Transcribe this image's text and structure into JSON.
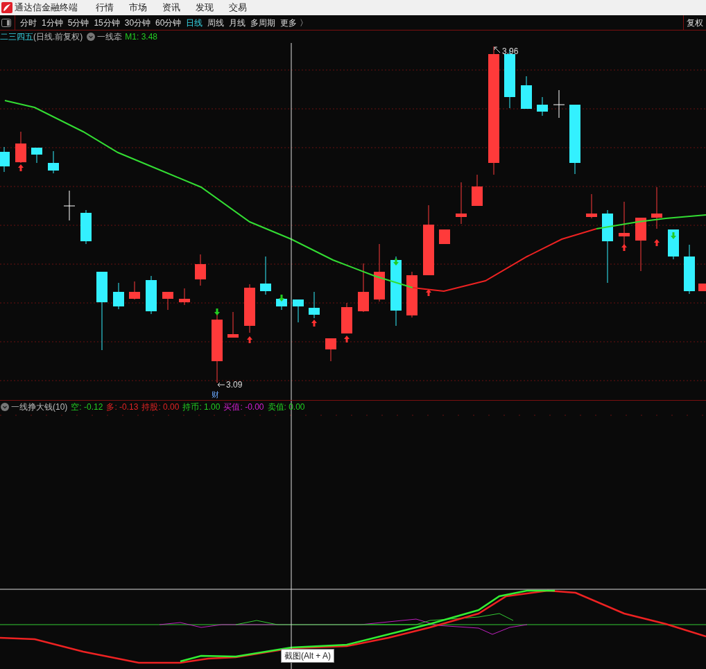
{
  "app": {
    "title": "通达信金融终端",
    "menu": [
      "行情",
      "市场",
      "资讯",
      "发现",
      "交易"
    ]
  },
  "periods": [
    {
      "label": "分时",
      "selected": false
    },
    {
      "label": "1分钟",
      "selected": false
    },
    {
      "label": "5分钟",
      "selected": false
    },
    {
      "label": "15分钟",
      "selected": false
    },
    {
      "label": "30分钟",
      "selected": false
    },
    {
      "label": "60分钟",
      "selected": false
    },
    {
      "label": "日线",
      "selected": true
    },
    {
      "label": "周线",
      "selected": false
    },
    {
      "label": "月线",
      "selected": false
    },
    {
      "label": "多周期",
      "selected": false
    },
    {
      "label": "更多 〉",
      "selected": false
    }
  ],
  "adjust_button": "复权",
  "main_chart": {
    "stock": "二三四五",
    "mode": "(日线.前复权)",
    "indicator": "一线牵",
    "reading": "M1: 3.48",
    "high_label": "3.96",
    "low_label": "3.09",
    "event_badge": "财"
  },
  "sub_chart": {
    "indicator": "一线挣大钱(10)",
    "readings": [
      {
        "label": "空:",
        "value": "-0.12",
        "color": "#22cc22"
      },
      {
        "label": "多:",
        "value": "-0.13",
        "color": "#e02424"
      },
      {
        "label": "持股:",
        "value": "0.00",
        "color": "#e02424"
      },
      {
        "label": "持币:",
        "value": "1.00",
        "color": "#22cc22"
      },
      {
        "label": "买值:",
        "value": "-0.00",
        "color": "#d020d0"
      },
      {
        "label": "卖值:",
        "value": "0.00",
        "color": "#22cc22"
      }
    ]
  },
  "tooltip": "截图(Alt + A)"
}
